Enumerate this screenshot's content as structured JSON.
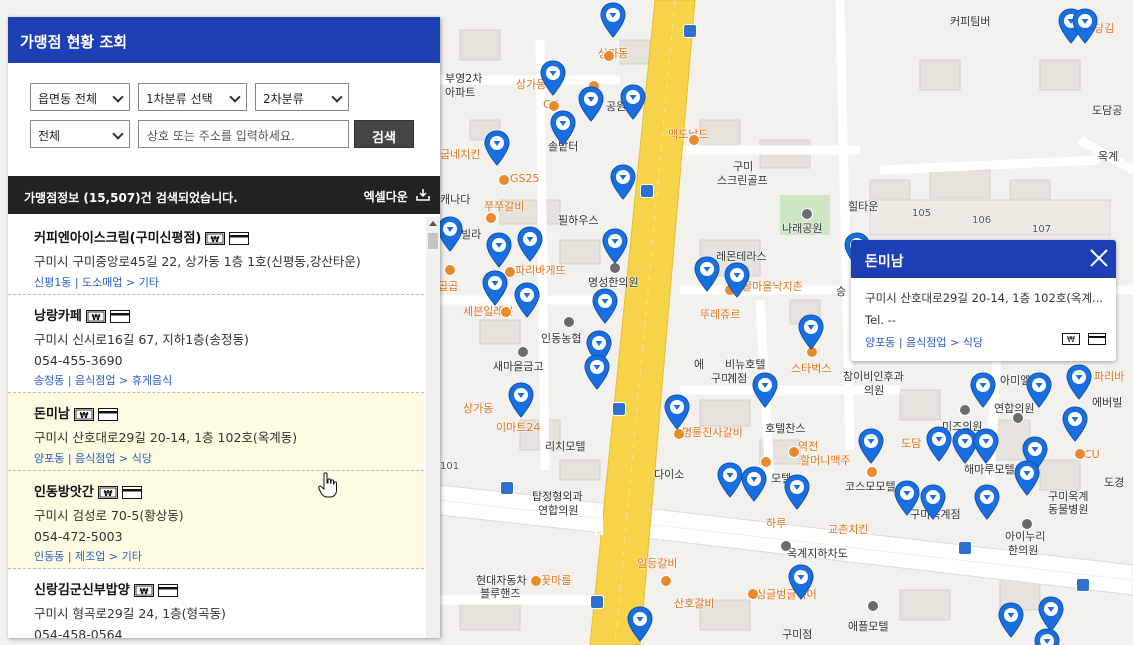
{
  "panel": {
    "title": "가맹점 현황 조회",
    "filters": {
      "region": "읍면동 전체",
      "category1": "1차분류 선택",
      "category2": "2차분류",
      "scope": "전체",
      "search_placeholder": "상호 또는 주소를 입력하세요.",
      "search_button": "검색"
    },
    "result_summary": "가맹점정보 (15,507)건 검색되었습니다.",
    "excel_download": "엑셀다운"
  },
  "stores": [
    {
      "name": "커피엔아이스크림(구미신평점)",
      "address": "구미시 구미중앙로45길 22, 상가동 1층 1호(신평동,강산타운)",
      "tel": "",
      "category": "신평1동 | 도소매업 > 기타",
      "highlighted": false
    },
    {
      "name": "낭랑카페",
      "address": "구미시 신시로16길 67, 지하1층(송정동)",
      "tel": "054-455-3690",
      "category": "송정동 | 음식점업 > 휴게음식",
      "highlighted": false
    },
    {
      "name": "돈미남",
      "address": "구미시 산호대로29길 20-14, 1층 102호(옥계동)",
      "tel": "",
      "category": "양포동 | 음식점업 > 식당",
      "highlighted": true
    },
    {
      "name": "인동방앗간",
      "address": "구미시 검성로 70-5(황상동)",
      "tel": "054-472-5003",
      "category": "인동동 | 제조업 > 기타",
      "highlighted": true
    },
    {
      "name": "신랑김군신부밥양",
      "address": "구미시 형곡로29길 24, 1층(형곡동)",
      "tel": "054-458-0564",
      "category": "",
      "highlighted": false
    }
  ],
  "popup": {
    "title": "돈미남",
    "address": "구미시 산호대로29길 20-14, 1층 102호(옥계...",
    "tel": "Tel. --",
    "category": "양포동 | 음식점업 > 식당"
  },
  "map": {
    "labels": [
      {
        "text": "커피팀버",
        "cls": ""
      },
      {
        "text": "상가동",
        "cls": "orange"
      },
      {
        "text": "부영2차",
        "cls": ""
      },
      {
        "text": "아파트",
        "cls": ""
      },
      {
        "text": "상가동",
        "cls": "orange"
      },
      {
        "text": "CU",
        "cls": "orange"
      },
      {
        "text": "공원",
        "cls": ""
      },
      {
        "text": "맥도날드",
        "cls": "orange"
      },
      {
        "text": "솔밭터",
        "cls": ""
      },
      {
        "text": "굽네치킨",
        "cls": "orange"
      },
      {
        "text": "구미",
        "cls": ""
      },
      {
        "text": "스크린골프",
        "cls": ""
      },
      {
        "text": "GS25",
        "cls": "orange"
      },
      {
        "text": "캐나다",
        "cls": ""
      },
      {
        "text": "쭈쭈갈비",
        "cls": "orange"
      },
      {
        "text": "필하우스",
        "cls": ""
      },
      {
        "text": "빌라",
        "cls": ""
      },
      {
        "text": "나래공원",
        "cls": ""
      },
      {
        "text": "힐타운",
        "cls": ""
      },
      {
        "text": "105",
        "cls": "grey"
      },
      {
        "text": "107",
        "cls": "grey"
      },
      {
        "text": "106",
        "cls": "grey"
      },
      {
        "text": "레몬테라스",
        "cls": ""
      },
      {
        "text": "파리바게뜨",
        "cls": "orange"
      },
      {
        "text": "명성한의원",
        "cls": ""
      },
      {
        "text": "곱곱",
        "cls": "orange"
      },
      {
        "text": "꿀마을낙지촌",
        "cls": "orange"
      },
      {
        "text": "승",
        "cls": ""
      },
      {
        "text": "세븐일레븐",
        "cls": "orange"
      },
      {
        "text": "뚜레쥬르",
        "cls": "orange"
      },
      {
        "text": "인동농협",
        "cls": ""
      },
      {
        "text": "새마을금고",
        "cls": ""
      },
      {
        "text": "에",
        "cls": ""
      },
      {
        "text": "비뉴호텔",
        "cls": ""
      },
      {
        "text": "구미",
        "cls": ""
      },
      {
        "text": "계점",
        "cls": ""
      },
      {
        "text": "스타벅스",
        "cls": "orange"
      },
      {
        "text": "참이비인후과",
        "cls": ""
      },
      {
        "text": "의원",
        "cls": ""
      },
      {
        "text": "아미엘",
        "cls": ""
      },
      {
        "text": "연합의원",
        "cls": ""
      },
      {
        "text": "파리바",
        "cls": "orange"
      },
      {
        "text": "에버빌",
        "cls": ""
      },
      {
        "text": "상가동",
        "cls": "orange"
      },
      {
        "text": "이마트24",
        "cls": "orange"
      },
      {
        "text": "명륜진사갈비",
        "cls": "orange"
      },
      {
        "text": "호텔찬스",
        "cls": ""
      },
      {
        "text": "역전",
        "cls": "orange"
      },
      {
        "text": "할머니맥주",
        "cls": "orange"
      },
      {
        "text": "미즈의원",
        "cls": ""
      },
      {
        "text": "도담",
        "cls": "orange"
      },
      {
        "text": "리치모텔",
        "cls": ""
      },
      {
        "text": "다이소",
        "cls": ""
      },
      {
        "text": "해마루모텔",
        "cls": ""
      },
      {
        "text": "CU",
        "cls": "orange"
      },
      {
        "text": "모텔",
        "cls": ""
      },
      {
        "text": "코스모모텔",
        "cls": ""
      },
      {
        "text": "도경",
        "cls": ""
      },
      {
        "text": "탑정형외과",
        "cls": ""
      },
      {
        "text": "연합의원",
        "cls": ""
      },
      {
        "text": "구미옥계점",
        "cls": ""
      },
      {
        "text": "구미옥계",
        "cls": ""
      },
      {
        "text": "동물병원",
        "cls": ""
      },
      {
        "text": "하루",
        "cls": "orange"
      },
      {
        "text": "교촌치킨",
        "cls": "orange"
      },
      {
        "text": "아이누리",
        "cls": ""
      },
      {
        "text": "한의원",
        "cls": ""
      },
      {
        "text": "옥계지하차도",
        "cls": ""
      },
      {
        "text": "일등갈비",
        "cls": "orange"
      },
      {
        "text": "현대자동차",
        "cls": ""
      },
      {
        "text": "블루핸즈",
        "cls": ""
      },
      {
        "text": "꽃마름",
        "cls": "orange"
      },
      {
        "text": "산호갈비",
        "cls": "orange"
      },
      {
        "text": "싱글벙글복어",
        "cls": "orange"
      },
      {
        "text": "애플모텔",
        "cls": ""
      },
      {
        "text": "구미점",
        "cls": ""
      },
      {
        "text": "도담공",
        "cls": ""
      },
      {
        "text": "당김",
        "cls": "orange"
      },
      {
        "text": "101",
        "cls": "grey"
      },
      {
        "text": "옥계",
        "cls": ""
      }
    ]
  },
  "colors": {
    "header_blue": "#1c3fb4",
    "pin_blue": "#1a6fe0",
    "link_blue": "#2a5ec8",
    "highlight_bg": "#fdfbe1",
    "road_yellow": "#f7d34a"
  }
}
